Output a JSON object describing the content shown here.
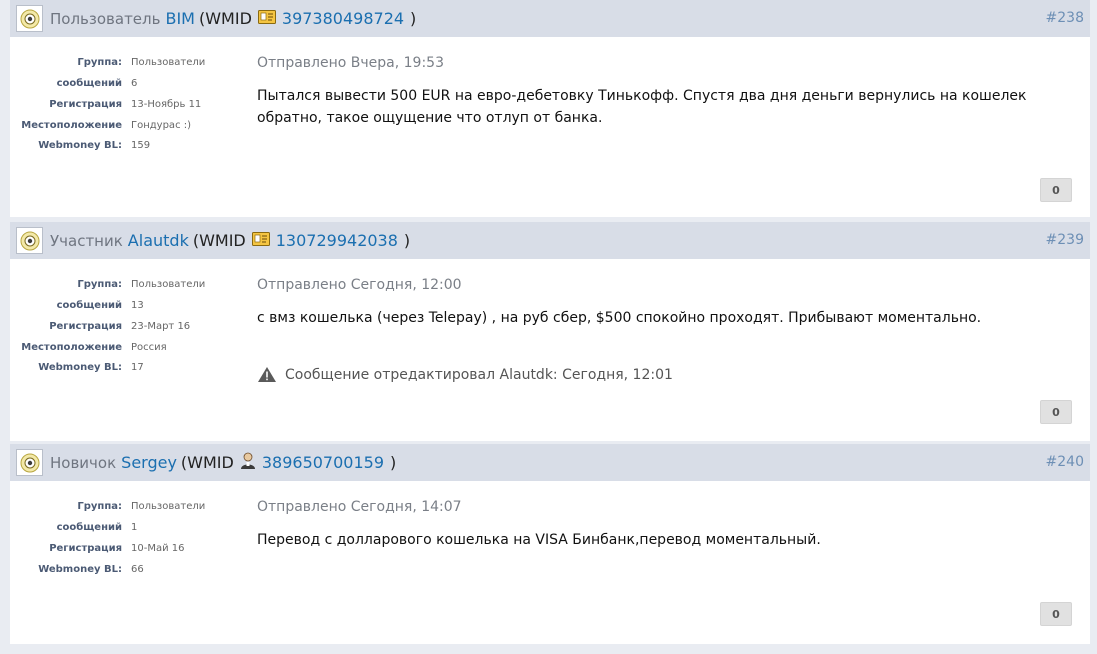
{
  "labels": {
    "group": "Группа:",
    "posts": "сообщений",
    "registration": "Регистрация",
    "location": "Местоположение",
    "webmoney_bl": "Webmoney BL:",
    "wmid": "WMID"
  },
  "posts": [
    {
      "rank": "Пользователь",
      "username": "BIM",
      "wmid": "397380498724",
      "wmid_icon": "id-card-icon",
      "number": "#238",
      "group": "Пользователи",
      "post_count": "6",
      "registration": "13-Ноябрь 11",
      "location": "Гондурас :)",
      "webmoney_bl": "159",
      "date": "Отправлено Вчера, 19:53",
      "text": "Пытался вывести 500 EUR на евро-дебетовку Тинькофф. Спустя два дня деньги вернулись на кошелек обратно, такое ощущение что отлуп от банка.",
      "edited": "",
      "reputation": "0"
    },
    {
      "rank": "Участник",
      "username": "Alautdk",
      "wmid": "130729942038",
      "wmid_icon": "id-card-icon",
      "number": "#239",
      "group": "Пользователи",
      "post_count": "13",
      "registration": "23-Март 16",
      "location": "Россия",
      "webmoney_bl": "17",
      "date": "Отправлено Сегодня, 12:00",
      "text": "с вмз кошелька (через Telepay) , на руб сбер, $500 спокойно проходят. Прибывают моментально.",
      "edited": "Сообщение отредактировал Alautdk: Сегодня, 12:01",
      "reputation": "0"
    },
    {
      "rank": "Новичок",
      "username": "Sergey",
      "wmid": "389650700159",
      "wmid_icon": "person-icon",
      "number": "#240",
      "group": "Пользователи",
      "post_count": "1",
      "registration": "10-Май 16",
      "location": "",
      "webmoney_bl": "66",
      "date": "Отправлено Сегодня, 14:07",
      "text": "Перевод с долларового кошелька на VISA Бинбанк,перевод моментальный.",
      "edited": "",
      "reputation": "0"
    }
  ]
}
